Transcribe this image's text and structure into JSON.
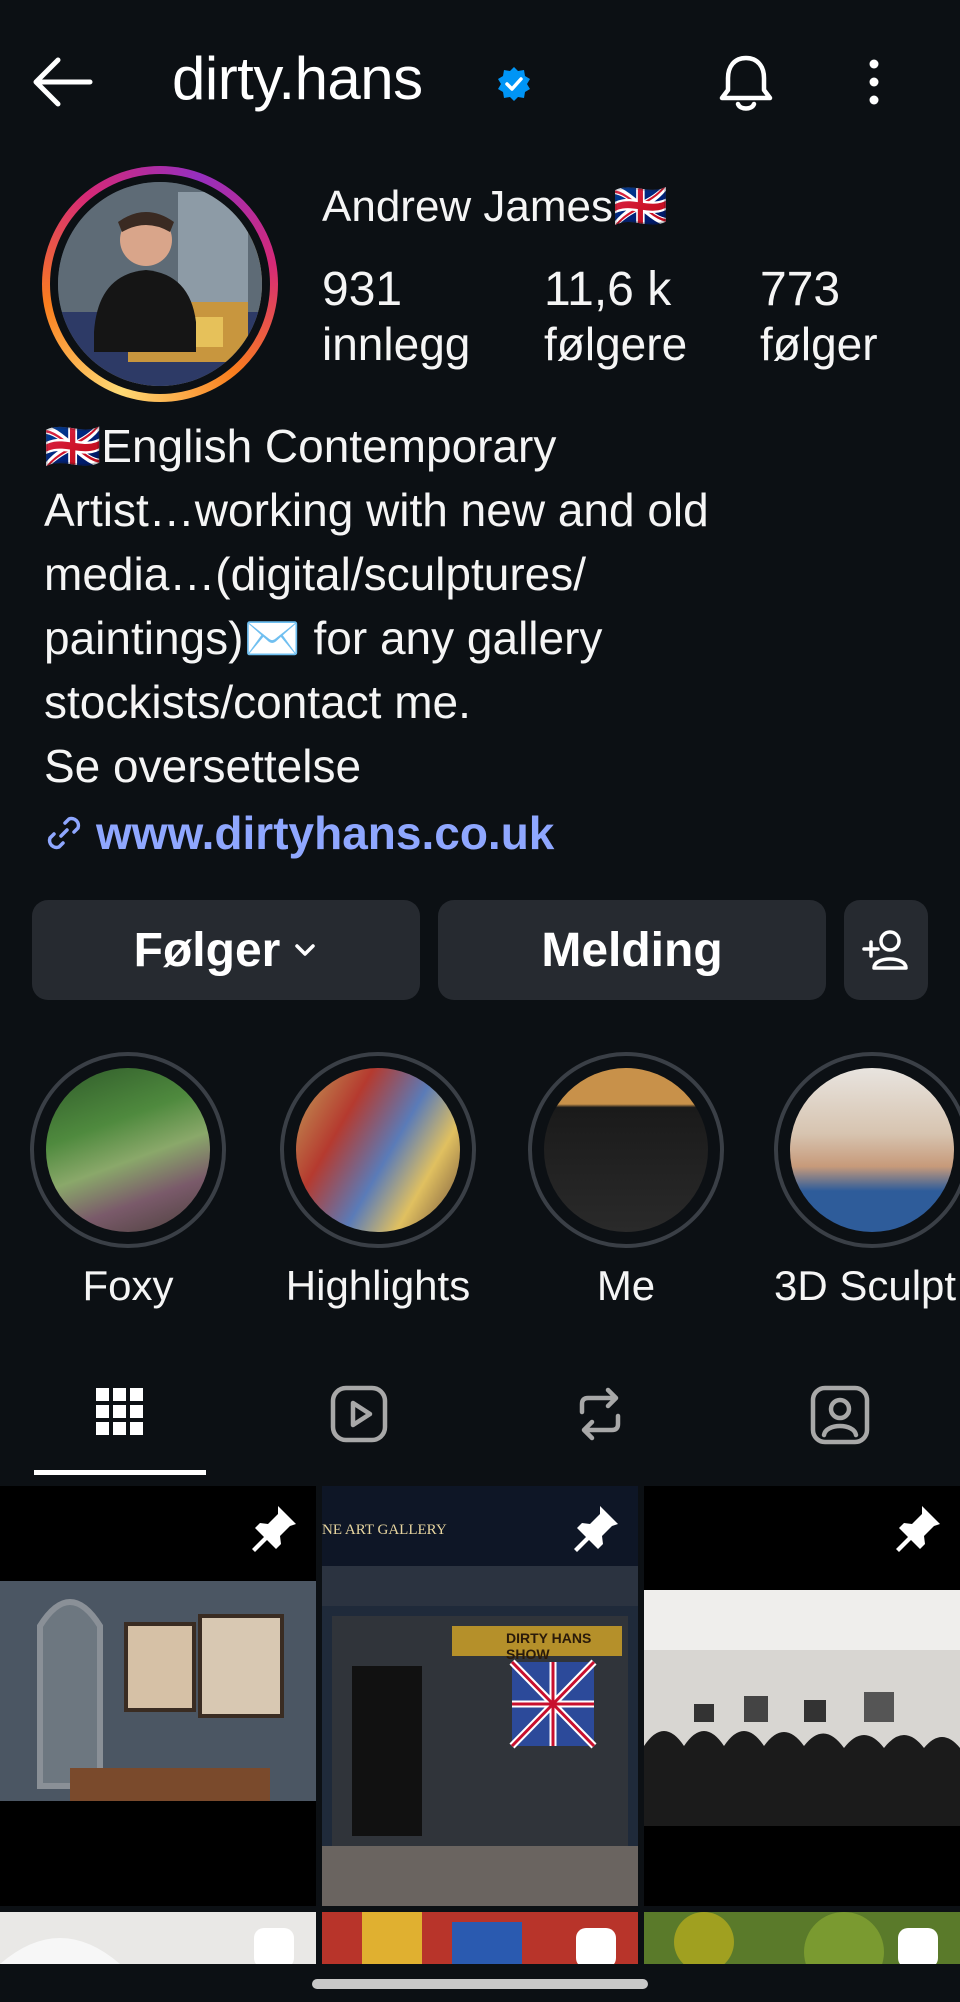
{
  "header": {
    "username": "dirty.hans",
    "back_icon": "arrow-left-icon",
    "verified_icon": "verified-badge-icon",
    "bell_icon": "bell-icon",
    "more_icon": "more-vertical-icon"
  },
  "profile": {
    "display_name": "Andrew James🇬🇧",
    "stats": [
      {
        "num": "931",
        "label": "innlegg"
      },
      {
        "num": "11,6 k",
        "label": "følgere"
      },
      {
        "num": "773",
        "label": "følger"
      }
    ],
    "bio_lines": [
      "🇬🇧English Contemporary",
      "Artist…working with new and old",
      "media…(digital/sculptures/",
      "paintings)✉️ for any gallery",
      "stockists/contact me.",
      "Se oversettelse"
    ],
    "link_text": "www.dirtyhans.co.uk"
  },
  "actions": {
    "following_label": "Følger",
    "message_label": "Melding"
  },
  "highlights": [
    {
      "label": "Foxy"
    },
    {
      "label": "Highlights"
    },
    {
      "label": "Me"
    },
    {
      "label": "3D Sculpt…"
    }
  ],
  "posts": [
    {
      "overlay": ""
    },
    {
      "overlay": "NE ART GALLERY"
    },
    {
      "overlay": ""
    },
    {
      "overlay": ""
    },
    {
      "overlay": "DIRTY HANS SHOW"
    },
    {
      "overlay": ""
    }
  ],
  "colors": {
    "background": "#0c1014",
    "button": "#262a30",
    "link": "#8fa7ff",
    "verified": "#0095f6"
  }
}
